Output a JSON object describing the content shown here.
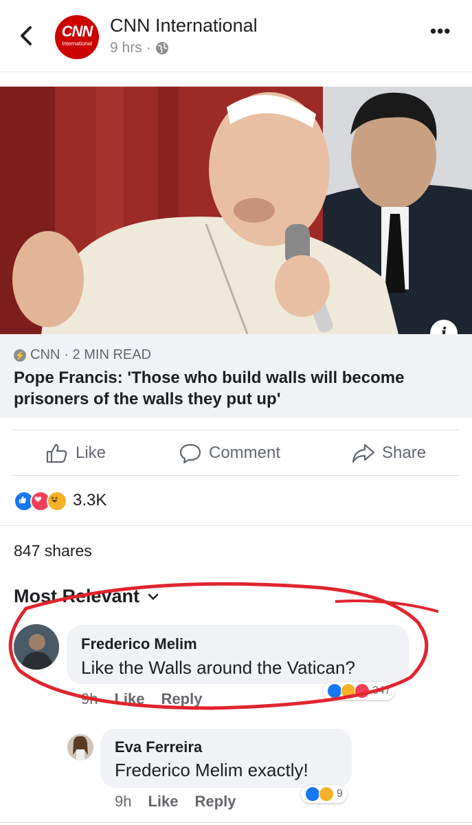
{
  "header": {
    "page_name": "CNN International",
    "time": "9 hrs",
    "dot": "·",
    "logo_text": "CNN",
    "logo_sub": "International",
    "more_label": "•••"
  },
  "article": {
    "info_label": "i",
    "source": "CNN",
    "source_meta": "· 2 MIN READ",
    "headline": "Pope Francis: 'Those who build walls will become prisoners of the walls they put up'"
  },
  "actions": {
    "like": "Like",
    "comment": "Comment",
    "share": "Share"
  },
  "stats": {
    "reaction_count": "3.3K",
    "shares": "847 shares"
  },
  "comments_section": {
    "sort_label": "Most Relevant"
  },
  "comments": [
    {
      "author": "Frederico Melim",
      "text": "Like the Walls around the Vatican?",
      "time": "9h",
      "like": "Like",
      "reply": "Reply",
      "reaction_count": "347"
    },
    {
      "author": "Eva Ferreira",
      "text": "Frederico Melim exactly!",
      "time": "9h",
      "like": "Like",
      "reply": "Reply",
      "reaction_count": "9"
    }
  ],
  "colors": {
    "brand_blue": "#1877f2",
    "cnn_red": "#cc0000",
    "annotation_red": "#e0252e"
  }
}
